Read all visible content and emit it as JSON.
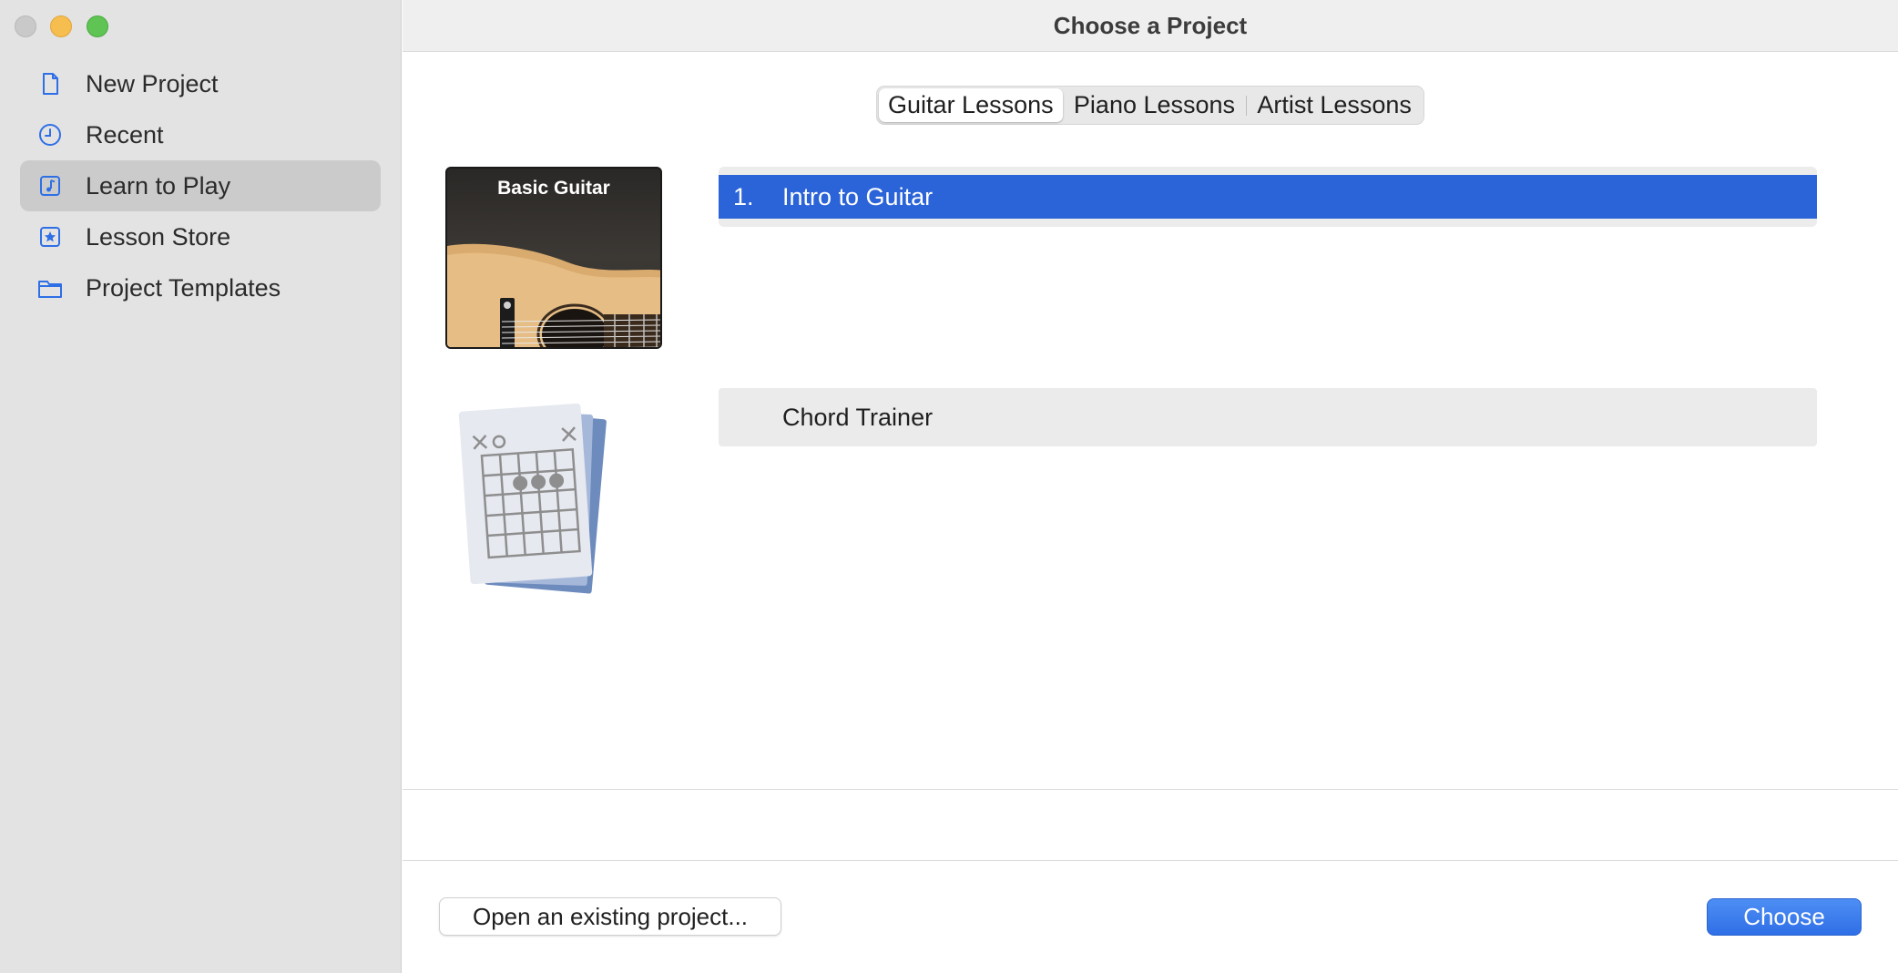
{
  "window": {
    "title": "Choose a Project"
  },
  "sidebar": {
    "items": [
      {
        "label": "New Project",
        "icon": "document-icon"
      },
      {
        "label": "Recent",
        "icon": "clock-icon"
      },
      {
        "label": "Learn to Play",
        "icon": "music-note-icon",
        "selected": true
      },
      {
        "label": "Lesson Store",
        "icon": "star-icon"
      },
      {
        "label": "Project Templates",
        "icon": "folder-icon"
      }
    ]
  },
  "tabs": [
    {
      "label": "Guitar Lessons",
      "selected": true
    },
    {
      "label": "Piano Lessons",
      "selected": false
    },
    {
      "label": "Artist Lessons",
      "selected": false
    }
  ],
  "lessons": {
    "basic_guitar": {
      "thumbnail_title": "Basic Guitar",
      "items": [
        {
          "number": "1.",
          "label": "Intro to Guitar",
          "selected": true
        }
      ]
    },
    "chord_trainer": {
      "label": "Chord Trainer"
    }
  },
  "footer": {
    "open_label": "Open an existing project...",
    "choose_label": "Choose"
  },
  "colors": {
    "accent": "#2b63d8",
    "sidebar_bg": "#e3e3e3",
    "icon_blue": "#2f6fe6"
  }
}
